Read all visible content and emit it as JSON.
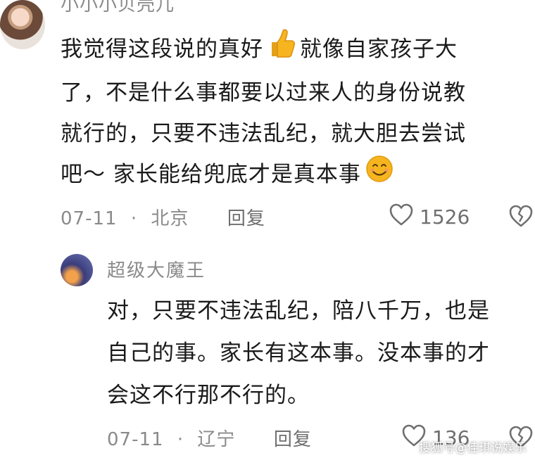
{
  "comments": [
    {
      "username": "小小小贝壳儿",
      "text_lines": [
        "我觉得这段说的真好",
        "就像自家孩子大",
        "了，不是什么事都要以过来人的身份说教",
        "就行的，只要不违法乱纪，就大胆去尝试",
        "吧～ 家长能给兜底才是真本事"
      ],
      "emoji_1": "thumbs-up-icon",
      "emoji_2": "smile-icon",
      "date": "07-11",
      "separator": "·",
      "location": "北京",
      "reply_label": "回复",
      "likes": "1526"
    },
    {
      "username": "超级大魔王",
      "text_lines": [
        "对，只要不违法乱纪，陪八千万，也是",
        "自己的事。家长有这本事。没本事的才",
        "会这不行那不行的。"
      ],
      "date": "07-11",
      "separator": "·",
      "location": "辽宁",
      "reply_label": "回复",
      "likes": "136"
    }
  ],
  "watermark": "搜狐号@佳琪说娱乐",
  "colors": {
    "text": "#1a1a1a",
    "meta": "#8a8a8a",
    "icon": "#6f6f6f",
    "emoji_yellow": "#f6b51f"
  }
}
